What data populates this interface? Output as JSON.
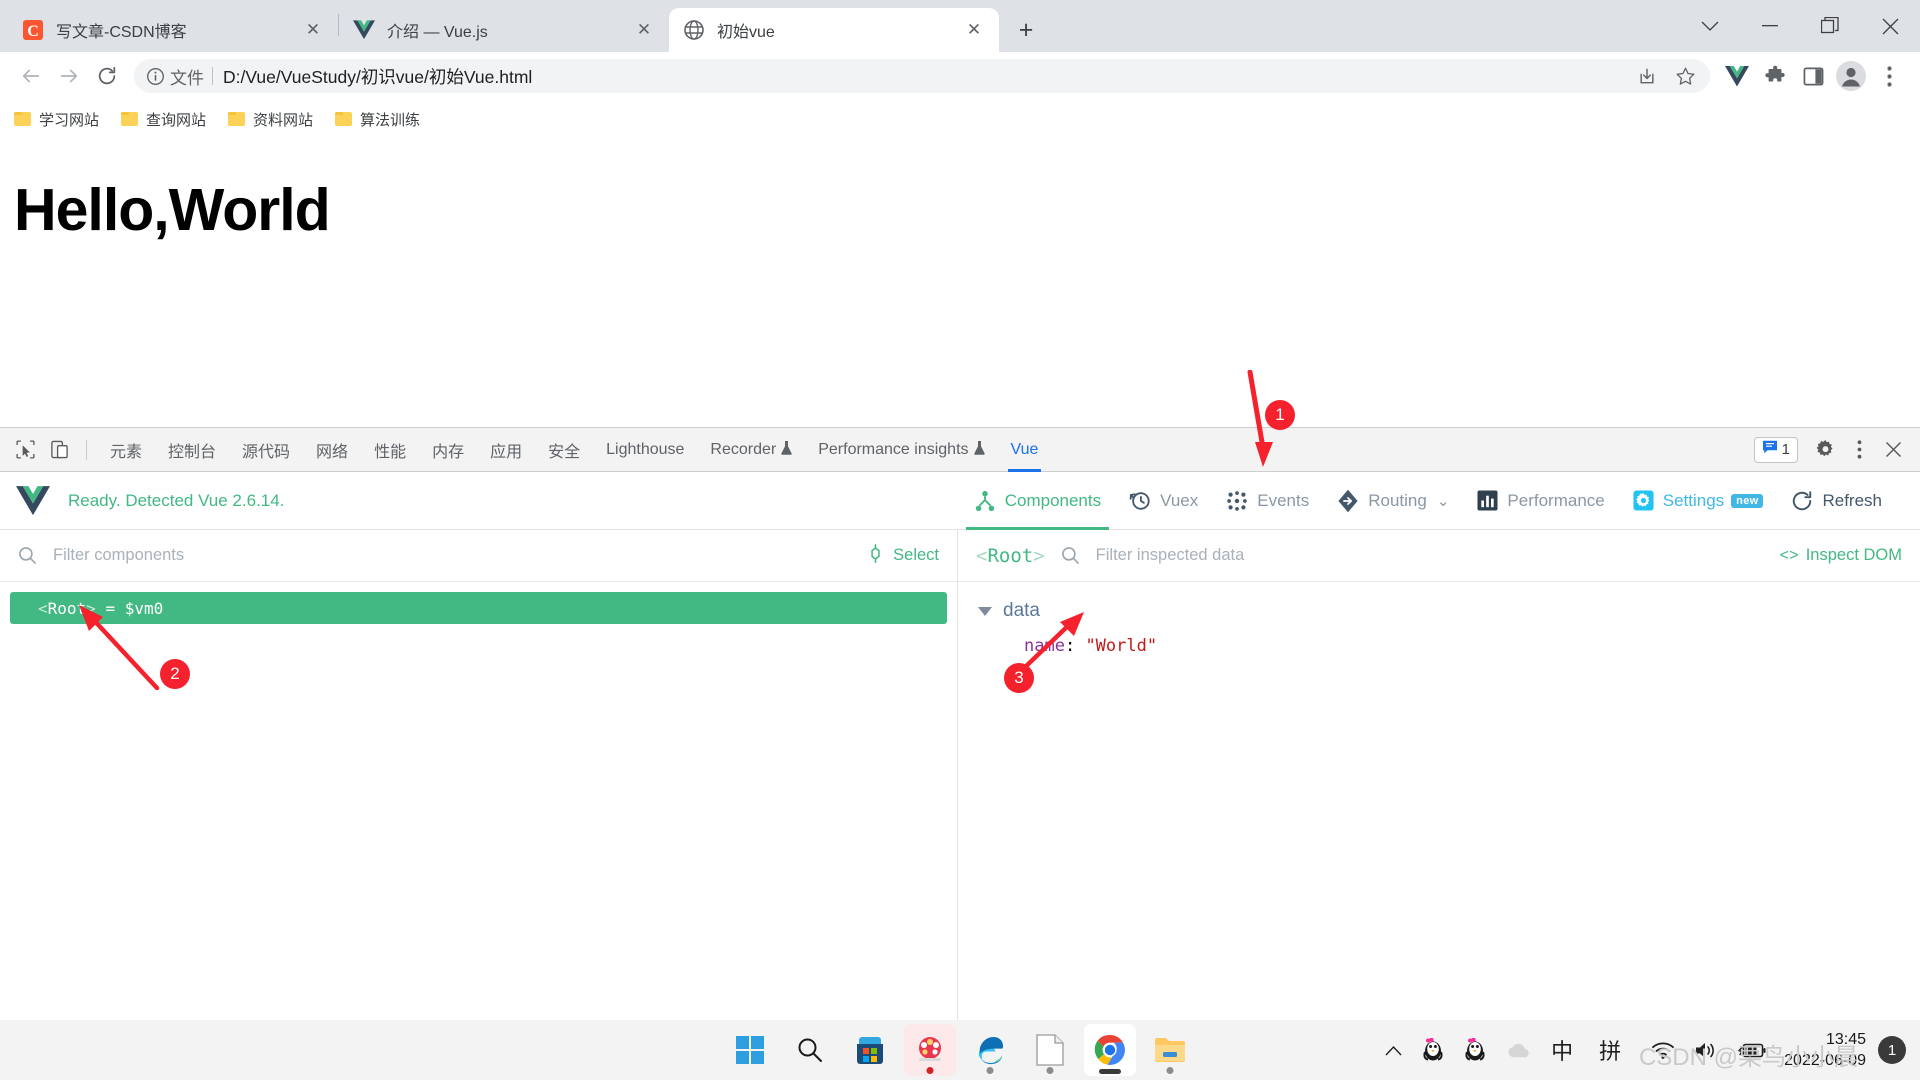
{
  "browser": {
    "tabs": [
      {
        "title": "写文章-CSDN博客",
        "favicon": "csdn-icon",
        "active": false,
        "close_label": "✕"
      },
      {
        "title": "介绍 — Vue.js",
        "favicon": "vue-icon",
        "active": false,
        "close_label": "✕"
      },
      {
        "title": "初始vue",
        "favicon": "globe-icon",
        "active": true,
        "close_label": "✕"
      }
    ],
    "new_tab_label": "+",
    "window_controls": {
      "expand": "⌄",
      "minimize": "—",
      "maximize": "❐",
      "close": "✕"
    },
    "toolbar": {
      "back": "←",
      "forward": "→",
      "reload": "⟳",
      "omnibox": {
        "scheme_label": "文件",
        "url": "D:/Vue/VueStudy/初识vue/初始Vue.html",
        "info_icon": "info-circle-icon",
        "share_icon": "share-icon",
        "bookmark_icon": "star-icon"
      },
      "extensions": [
        "vue-devtools-icon",
        "puzzle-icon",
        "side-panel-icon"
      ],
      "profile_icon": "avatar-icon",
      "menu_icon": "kebab-menu-icon"
    },
    "bookmarks": [
      {
        "label": "学习网站"
      },
      {
        "label": "查询网站"
      },
      {
        "label": "资料网站"
      },
      {
        "label": "算法训练"
      }
    ]
  },
  "page": {
    "heading": "Hello,World"
  },
  "devtools": {
    "tools": [
      "inspect-element-icon",
      "device-toolbar-icon"
    ],
    "tabs": [
      {
        "label": "元素",
        "selected": false,
        "experimental": false
      },
      {
        "label": "控制台",
        "selected": false,
        "experimental": false
      },
      {
        "label": "源代码",
        "selected": false,
        "experimental": false
      },
      {
        "label": "网络",
        "selected": false,
        "experimental": false
      },
      {
        "label": "性能",
        "selected": false,
        "experimental": false
      },
      {
        "label": "内存",
        "selected": false,
        "experimental": false
      },
      {
        "label": "应用",
        "selected": false,
        "experimental": false
      },
      {
        "label": "安全",
        "selected": false,
        "experimental": false
      },
      {
        "label": "Lighthouse",
        "selected": false,
        "experimental": false
      },
      {
        "label": "Recorder",
        "selected": false,
        "experimental": true
      },
      {
        "label": "Performance insights",
        "selected": false,
        "experimental": true
      },
      {
        "label": "Vue",
        "selected": true,
        "experimental": false
      }
    ],
    "issues_count": "1",
    "settings_icon": "gear-icon",
    "more_icon": "kebab-menu-icon",
    "close_icon": "close-icon"
  },
  "vue_devtools": {
    "status": "Ready. Detected Vue 2.6.14.",
    "logo": "vue-logo-icon",
    "nav": [
      {
        "label": "Components",
        "icon": "components-tree-icon",
        "active": true
      },
      {
        "label": "Vuex",
        "icon": "history-clock-icon",
        "active": false
      },
      {
        "label": "Events",
        "icon": "events-dots-icon",
        "active": false
      },
      {
        "label": "Routing",
        "icon": "routing-diamond-icon",
        "active": false,
        "chevron": "⌄"
      },
      {
        "label": "Performance",
        "icon": "bar-chart-icon",
        "active": false
      },
      {
        "label": "Settings",
        "icon": "settings-gear-icon",
        "active": false,
        "badge": "new"
      },
      {
        "label": "Refresh",
        "icon": "refresh-icon",
        "active": false
      }
    ],
    "components_pane": {
      "filter_placeholder": "Filter components",
      "select_label": "Select",
      "tree": [
        {
          "tag_open": "<",
          "name": "Root",
          "tag_close": ">",
          "suffix": "= $vm0",
          "selected": true
        }
      ]
    },
    "inspector_pane": {
      "component_open": "<",
      "component_name": "Root",
      "component_close": ">",
      "filter_placeholder": "Filter inspected data",
      "inspect_dom_label": "Inspect DOM",
      "sections": [
        {
          "name": "data",
          "expanded": true,
          "props": [
            {
              "key": "name",
              "value": "\"World\""
            }
          ]
        }
      ]
    }
  },
  "annotations": [
    {
      "number": "1",
      "target": "vue-devtools-tab"
    },
    {
      "number": "2",
      "target": "root-component-row"
    },
    {
      "number": "3",
      "target": "data-name-value"
    }
  ],
  "taskbar": {
    "apps": [
      {
        "name": "start-windows-icon",
        "running": false
      },
      {
        "name": "search-icon",
        "running": false
      },
      {
        "name": "microsoft-store-icon",
        "running": false
      },
      {
        "name": "game-app-icon",
        "running": true,
        "indicator": "red"
      },
      {
        "name": "microsoft-edge-icon",
        "running": true
      },
      {
        "name": "notepad-icon",
        "running": true
      },
      {
        "name": "google-chrome-icon",
        "running": true,
        "active": true
      },
      {
        "name": "file-explorer-icon",
        "running": true
      }
    ],
    "tray": [
      {
        "name": "chevron-up-icon",
        "glyph": "⌃"
      },
      {
        "name": "qq-penguin-icon",
        "glyph": "🐧"
      },
      {
        "name": "qq-penguin-2-icon",
        "glyph": "🐧"
      },
      {
        "name": "onedrive-cloud-icon",
        "glyph": "☁"
      },
      {
        "name": "ime-chinese-icon",
        "glyph": "中"
      },
      {
        "name": "ime-pinyin-icon",
        "glyph": "拼"
      },
      {
        "name": "wifi-icon",
        "glyph": "📶"
      },
      {
        "name": "volume-icon",
        "glyph": "🔊"
      },
      {
        "name": "battery-charging-icon",
        "glyph": "🔋"
      }
    ],
    "clock": {
      "time": "13:45",
      "date": "2022-06-09"
    },
    "notification_count": "1"
  },
  "watermark": "CSDN @栗鸟小小晨",
  "colors": {
    "vue_green": "#42b883",
    "devtools_blue": "#1a73e8",
    "settings_blue": "#41b7e6",
    "annotation_red": "#f5222d"
  }
}
